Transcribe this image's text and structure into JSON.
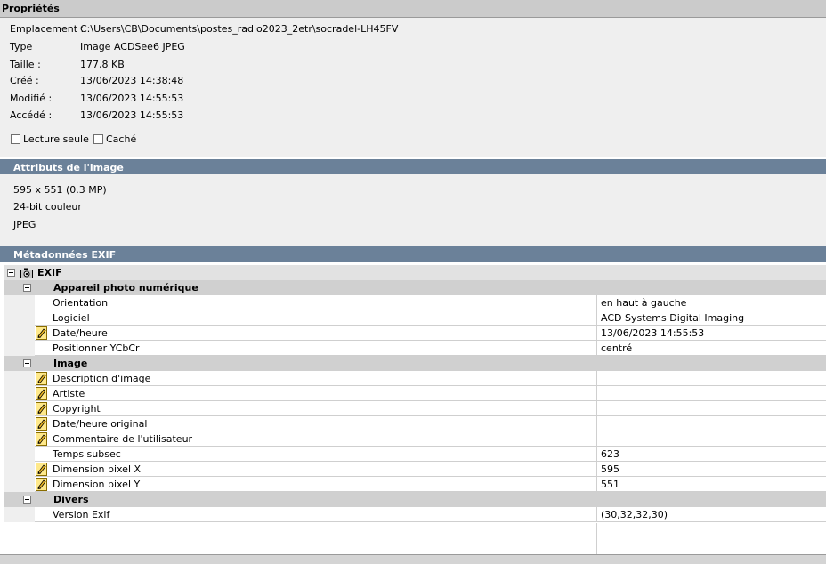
{
  "properties": {
    "title": "Propriétés",
    "rows": [
      {
        "label": "Emplacement :",
        "value": "C:\\Users\\CB\\Documents\\postes_radio2023_2etr\\socradel-LH45FV"
      },
      {
        "label": "Type",
        "value": "Image ACDSee6 JPEG"
      },
      {
        "label": "Taille :",
        "value": "177,8 KB"
      },
      {
        "label": "Créé :",
        "value": "13/06/2023 14:38:48"
      },
      {
        "label": "Modifié :",
        "value": "13/06/2023 14:55:53"
      },
      {
        "label": "Accédé :",
        "value": "13/06/2023 14:55:53"
      }
    ],
    "readonly_label": "Lecture seule",
    "hidden_label": "Caché"
  },
  "attributes": {
    "title": "Attributs de l'image",
    "dimensions": "595 x 551 (0.3 MP)",
    "color": "24-bit couleur",
    "format": "JPEG"
  },
  "exif": {
    "title": "Métadonnées EXIF",
    "root_label": "EXIF",
    "groups": [
      {
        "label": "Appareil photo numérique",
        "items": [
          {
            "name": "Orientation",
            "value": "en haut à gauche",
            "editable": false
          },
          {
            "name": "Logiciel",
            "value": "ACD Systems Digital Imaging",
            "editable": false
          },
          {
            "name": "Date/heure",
            "value": "13/06/2023 14:55:53",
            "editable": true
          },
          {
            "name": "Positionner YCbCr",
            "value": "centré",
            "editable": false
          }
        ]
      },
      {
        "label": "Image",
        "items": [
          {
            "name": "Description d'image",
            "value": "",
            "editable": true
          },
          {
            "name": "Artiste",
            "value": "",
            "editable": true
          },
          {
            "name": "Copyright",
            "value": "",
            "editable": true
          },
          {
            "name": "Date/heure original",
            "value": "",
            "editable": true
          },
          {
            "name": "Commentaire de l'utilisateur",
            "value": "",
            "editable": true
          },
          {
            "name": "Temps subsec",
            "value": "623",
            "editable": false
          },
          {
            "name": "Dimension pixel X",
            "value": "595",
            "editable": true
          },
          {
            "name": "Dimension pixel Y",
            "value": "551",
            "editable": true
          }
        ]
      },
      {
        "label": "Divers",
        "items": [
          {
            "name": "Version Exif",
            "value": "(30,32,32,30)",
            "editable": false
          }
        ]
      }
    ]
  }
}
